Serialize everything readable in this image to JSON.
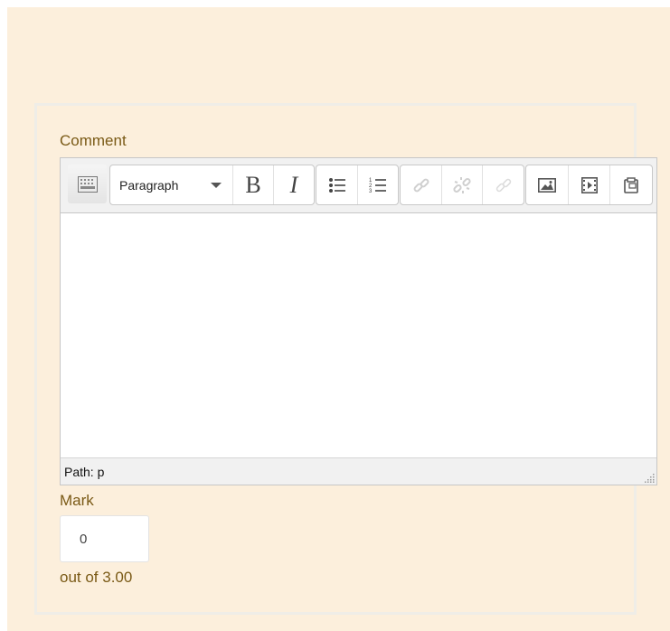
{
  "comment": {
    "label": "Comment",
    "editor": {
      "toolbar": {
        "kitchen_sink_icon": "toolbar-toggle-icon",
        "format_select": "Paragraph",
        "bold_label": "B",
        "italic_label": "I",
        "buttons": [
          {
            "name": "unordered-list",
            "icon": "bullet-list-icon",
            "enabled": true
          },
          {
            "name": "ordered-list",
            "icon": "numbered-list-icon",
            "enabled": true
          },
          {
            "name": "link",
            "icon": "link-icon",
            "enabled": false
          },
          {
            "name": "unlink",
            "icon": "unlink-icon",
            "enabled": false
          },
          {
            "name": "anchor",
            "icon": "anchor-link-icon",
            "enabled": false
          },
          {
            "name": "image",
            "icon": "image-icon",
            "enabled": true
          },
          {
            "name": "media",
            "icon": "media-icon",
            "enabled": true
          },
          {
            "name": "manage-files",
            "icon": "manage-files-icon",
            "enabled": true
          }
        ]
      },
      "content": "",
      "status_path": "Path: p"
    }
  },
  "mark": {
    "label": "Mark",
    "value": "0",
    "out_of": "out of 3.00"
  },
  "colors": {
    "page_background": "#fcefdc",
    "label_text": "#7a5a16",
    "toolbar_background": "#f1f1f1"
  }
}
